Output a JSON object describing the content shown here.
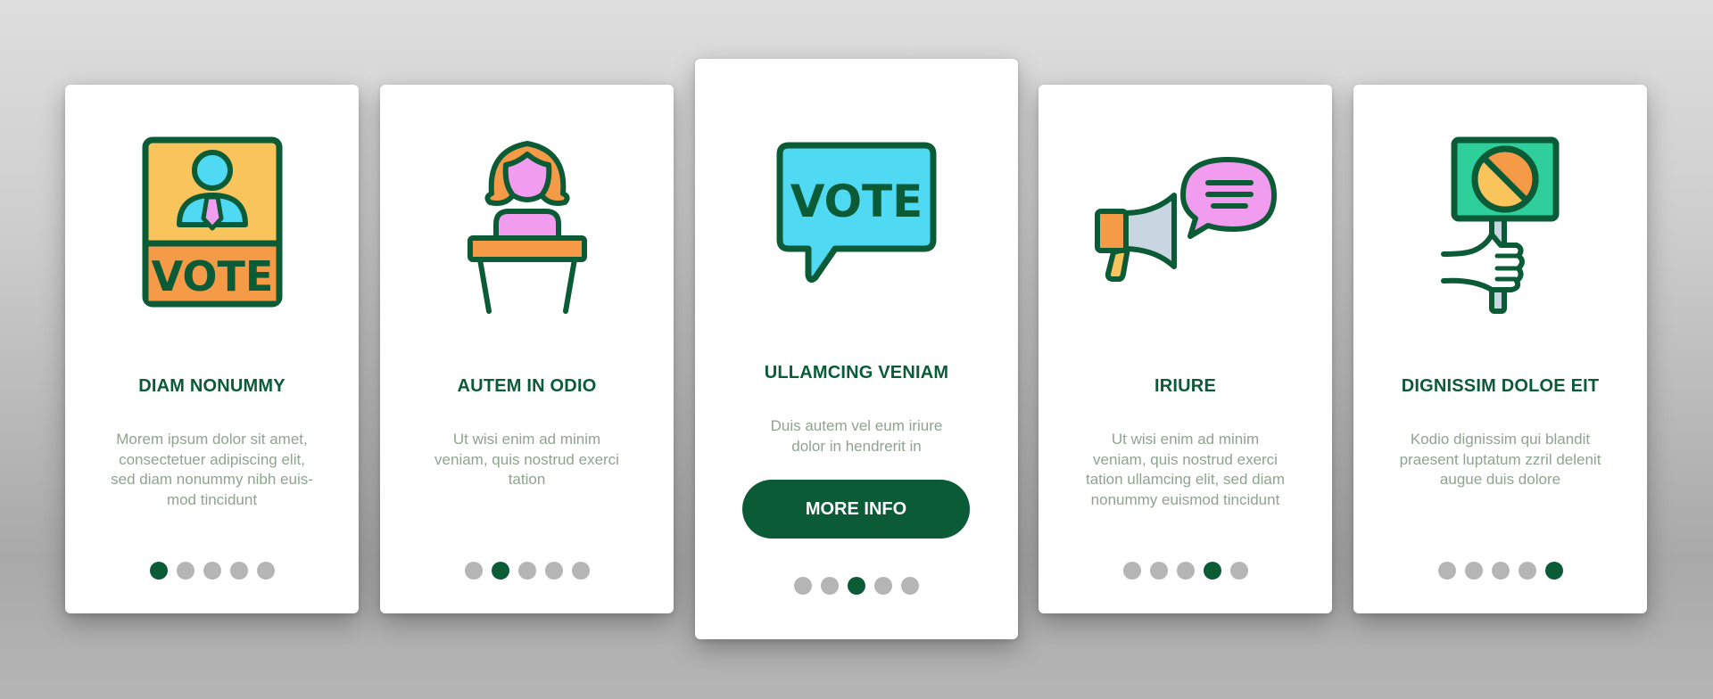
{
  "colors": {
    "primary": "#0b5b37",
    "body_text": "#8fa48f",
    "dot_inactive": "#b5b5b5",
    "card_bg": "#ffffff"
  },
  "cards": [
    {
      "icon": "vote-poster-icon",
      "title": "DIAM NONUMMY",
      "body": "Morem ipsum dolor sit amet,\nconsectetuer adipiscing elit,\nsed diam nonummy nibh euis-\nmod tincidunt",
      "icon_text": "VOTE",
      "active_page": 1,
      "total_pages": 5
    },
    {
      "icon": "speaker-podium-icon",
      "title": "AUTEM IN ODIO",
      "body": "Ut wisi enim ad minim\nveniam, quis nostrud exerci\ntation",
      "active_page": 2,
      "total_pages": 5
    },
    {
      "icon": "vote-speech-bubble-icon",
      "title": "ULLAMCING VENIAM",
      "body": "Duis autem vel eum iriure\ndolor in hendrerit in",
      "icon_text": "VOTE",
      "button_label": "MORE INFO",
      "active_page": 3,
      "total_pages": 5
    },
    {
      "icon": "megaphone-chat-icon",
      "title": "IRIURE",
      "body": "Ut wisi enim ad minim\nveniam, quis nostrud exerci\ntation ullamcing elit, sed diam\nnonummy euismod tincidunt",
      "active_page": 4,
      "total_pages": 5
    },
    {
      "icon": "protest-sign-icon",
      "title": "DIGNISSIM DOLOE EIT",
      "body": "Kodio dignissim qui blandit\npraesent luptatum zzril delenit\naugue duis dolore",
      "active_page": 5,
      "total_pages": 5
    }
  ]
}
